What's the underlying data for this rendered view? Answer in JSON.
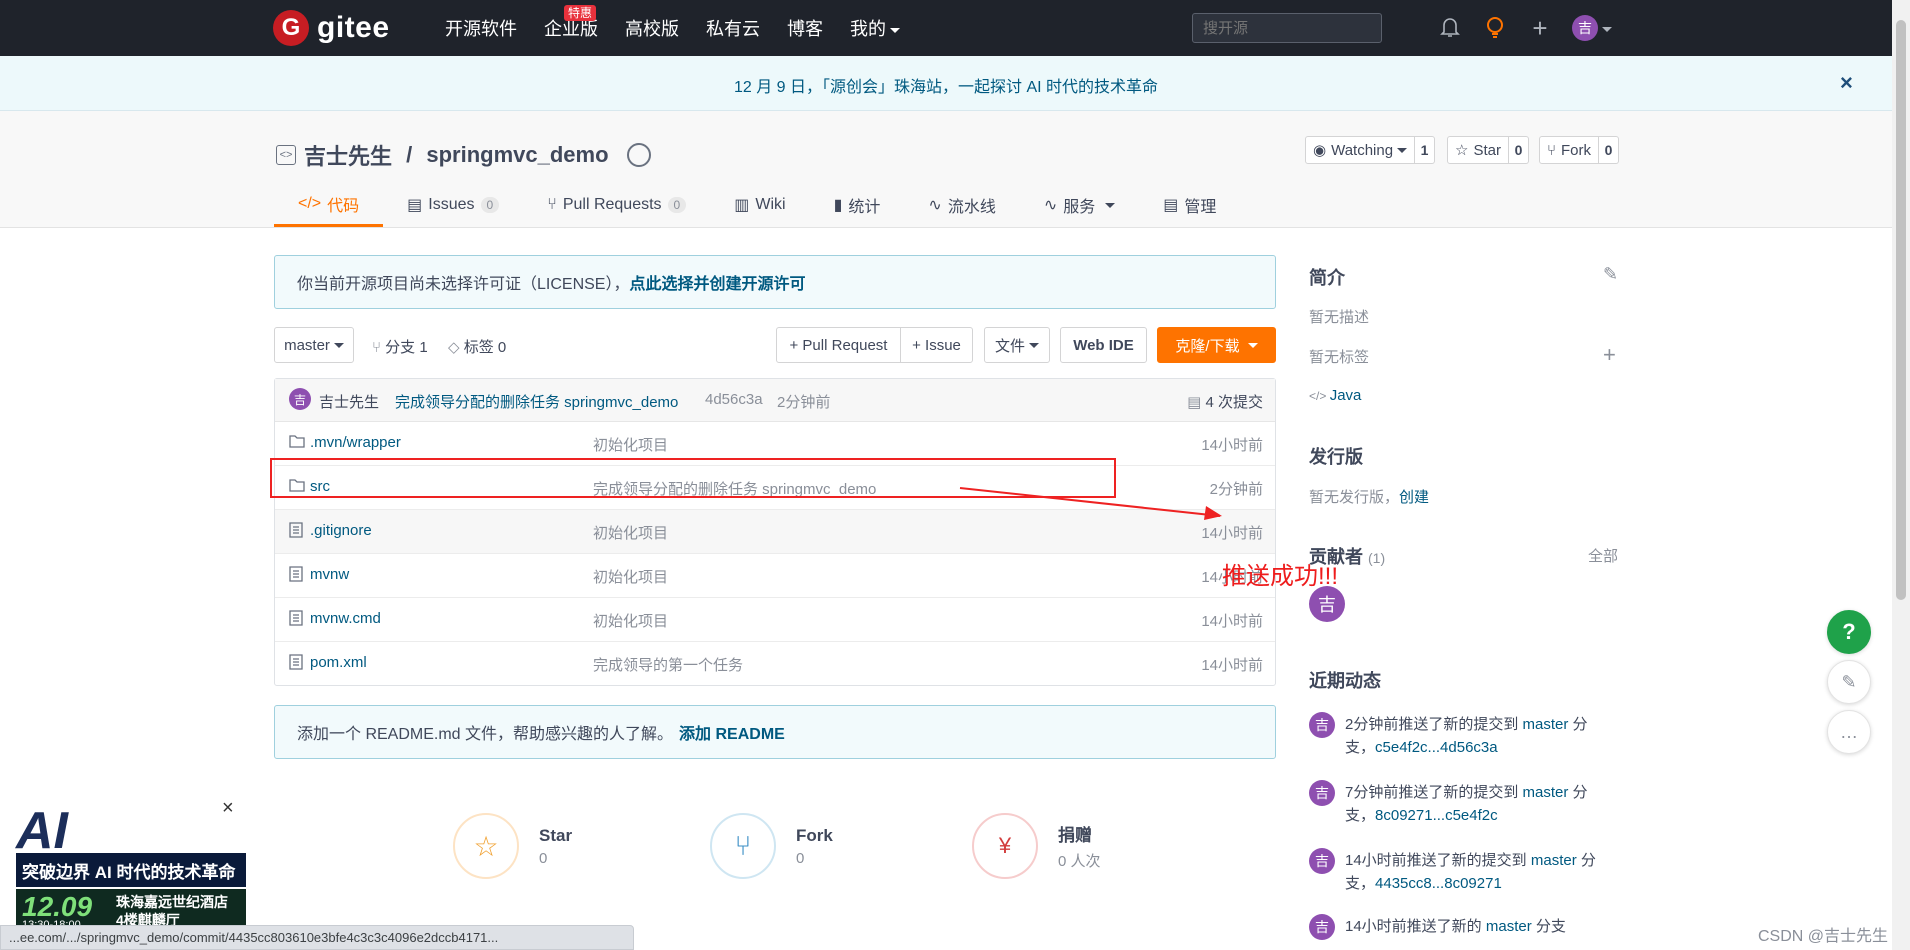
{
  "navbar": {
    "logo_mark": "G",
    "logo_text": "gitee",
    "links": [
      "开源软件",
      "企业版",
      "高校版",
      "私有云",
      "博客",
      "我的"
    ],
    "hot_badge": "特惠",
    "search_placeholder": "搜开源",
    "avatar": "吉"
  },
  "banner": {
    "text": "12 月 9 日，「源创会」珠海站，一起探讨 AI 时代的技术革命",
    "close": "×"
  },
  "repo": {
    "owner": "吉士先生",
    "separator": " / ",
    "name": "springmvc_demo",
    "watch_label": "Watching",
    "watch_count": "1",
    "star_label": "Star",
    "star_count": "0",
    "fork_label": "Fork",
    "fork_count": "0"
  },
  "tabs": [
    {
      "icon": "</>",
      "label": "代码"
    },
    {
      "icon": "▤",
      "label": "Issues",
      "count": "0"
    },
    {
      "icon": "⑂",
      "label": "Pull Requests",
      "count": "0"
    },
    {
      "icon": "▥",
      "label": "Wiki"
    },
    {
      "icon": "▮",
      "label": "统计"
    },
    {
      "icon": "∿",
      "label": "流水线"
    },
    {
      "icon": "∿",
      "label": "服务"
    },
    {
      "icon": "▤",
      "label": "管理"
    }
  ],
  "license": {
    "text": "你当前开源项目尚未选择许可证（LICENSE），",
    "link": "点此选择并创建开源许可"
  },
  "toolbar": {
    "branch": "master",
    "branches": "分支 1",
    "tags": "标签 0",
    "pull_request": "+ Pull Request",
    "issue": "+ Issue",
    "file": "文件",
    "web_ide": "Web IDE",
    "clone": "克隆/下载"
  },
  "commit": {
    "avatar": "吉",
    "author": "吉士先生",
    "message": "完成领导分配的删除任务 springmvc_demo",
    "hash": "4d56c3a",
    "time": "2分钟前",
    "count": "4 次提交"
  },
  "files": [
    {
      "icon": "folder",
      "name": ".mvn/wrapper",
      "message": "初始化项目",
      "time": "14小时前"
    },
    {
      "icon": "folder",
      "name": "src",
      "message": "完成领导分配的删除任务 springmvc_demo",
      "time": "2分钟前"
    },
    {
      "icon": "file",
      "name": ".gitignore",
      "message": "初始化项目",
      "time": "14小时前"
    },
    {
      "icon": "file",
      "name": "mvnw",
      "message": "初始化项目",
      "time": "14小时前"
    },
    {
      "icon": "file",
      "name": "mvnw.cmd",
      "message": "初始化项目",
      "time": "14小时前"
    },
    {
      "icon": "file",
      "name": "pom.xml",
      "message": "完成领导的第一个任务",
      "time": "14小时前"
    }
  ],
  "annotation": "推送成功!!!",
  "readme": {
    "text": "添加一个 README.md 文件，帮助感兴趣的人了解。",
    "link": "添加 README"
  },
  "stats": [
    {
      "label": "Star",
      "value": "0"
    },
    {
      "label": "Fork",
      "value": "0"
    },
    {
      "label": "捐赠",
      "value": "0 人次"
    }
  ],
  "sidebar": {
    "intro_title": "简介",
    "no_desc": "暂无描述",
    "no_tags": "暂无标签",
    "language": "Java",
    "release_title": "发行版",
    "no_release": "暂无发行版，",
    "create": "创建",
    "contrib_title": "贡献者",
    "contrib_count": "(1)",
    "all": "全部",
    "contrib_avatar": "吉",
    "activity_title": "近期动态",
    "activities": [
      {
        "pre": "2分钟前推送了新的提交到 ",
        "branch": "master",
        "post": " 分支，",
        "range": "c5e4f2c...4d56c3a"
      },
      {
        "pre": "7分钟前推送了新的提交到 ",
        "branch": "master",
        "post": " 分支，",
        "range": "8c09271...c5e4f2c"
      },
      {
        "pre": "14小时前推送了新的提交到 ",
        "branch": "master",
        "post": " 分支，",
        "range": "4435cc8...8c09271"
      },
      {
        "pre": "14小时前推送了新的 ",
        "branch": "master",
        "post": " 分支",
        "range": ""
      }
    ]
  },
  "floats": {
    "help": "?"
  },
  "ad": {
    "brand": "AI",
    "headline": "突破边界 AI 时代的技术革命",
    "date": "12.09",
    "location": "珠海嘉远世纪酒店 4楼麒麟厅",
    "time": "13:30-18:00",
    "close": "×"
  },
  "status_url": "...ee.com/.../springmvc_demo/commit/4435cc803610e3bfe4c3c3c4096e2dccb4171...",
  "watermark": "CSDN @吉士先生",
  "colors": {
    "accent": "#fe7300",
    "link": "#005980",
    "nav_bg": "#1f232b",
    "annotation": "#ee2222"
  }
}
